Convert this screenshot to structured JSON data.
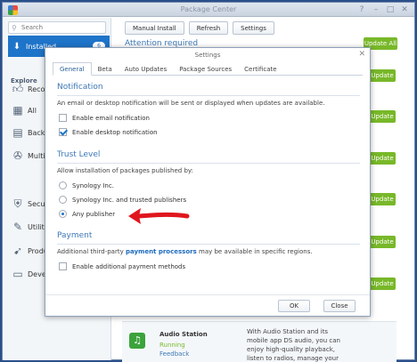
{
  "window": {
    "title": "Package Center"
  },
  "sidebar": {
    "search_placeholder": "Search",
    "installed": {
      "label": "Installed",
      "badge": "6"
    },
    "explore_label": "Explore",
    "items": [
      {
        "label": "Recommended",
        "icon": "thumbs-up-icon"
      },
      {
        "label": "All",
        "icon": "grid-icon"
      },
      {
        "label": "Backup",
        "icon": "backup-icon"
      },
      {
        "label": "Multimedia",
        "icon": "film-icon"
      },
      {
        "label": "Security",
        "icon": "shield-icon"
      },
      {
        "label": "Utilities",
        "icon": "wrench-icon"
      },
      {
        "label": "Productivity",
        "icon": "rocket-icon"
      },
      {
        "label": "Developer Tools",
        "icon": "code-icon"
      }
    ]
  },
  "toolbar": {
    "manual_install": "Manual Install",
    "refresh": "Refresh",
    "settings": "Settings"
  },
  "main": {
    "attention_heading": "Attention required",
    "update_all": "Update All",
    "update_label": "Update",
    "card": {
      "name": "Audio Station",
      "status": "Running",
      "feedback": "Feedback",
      "description": "With Audio Station and its mobile app DS audio, you can enjoy high-quality playback, listen to radios, manage your"
    }
  },
  "dialog": {
    "title": "Settings",
    "tabs": [
      "General",
      "Beta",
      "Auto Updates",
      "Package Sources",
      "Certificate"
    ],
    "notification": {
      "title": "Notification",
      "desc": "An email or desktop notification will be sent or displayed when updates are available.",
      "email_label": "Enable email notification",
      "desktop_label": "Enable desktop notification"
    },
    "trust": {
      "title": "Trust Level",
      "desc": "Allow installation of packages published by:",
      "options": [
        "Synology Inc.",
        "Synology Inc. and trusted publishers",
        "Any publisher"
      ],
      "selected": "Any publisher"
    },
    "payment": {
      "title": "Payment",
      "desc_before": "Additional third-party ",
      "desc_link": "payment processors",
      "desc_after": " may be available in specific regions.",
      "enable_label": "Enable additional payment methods"
    },
    "ok": "OK",
    "close": "Close"
  },
  "colors": {
    "accent": "#1e74c9",
    "update_green": "#78b829",
    "annotation_arrow": "#e0161e"
  }
}
